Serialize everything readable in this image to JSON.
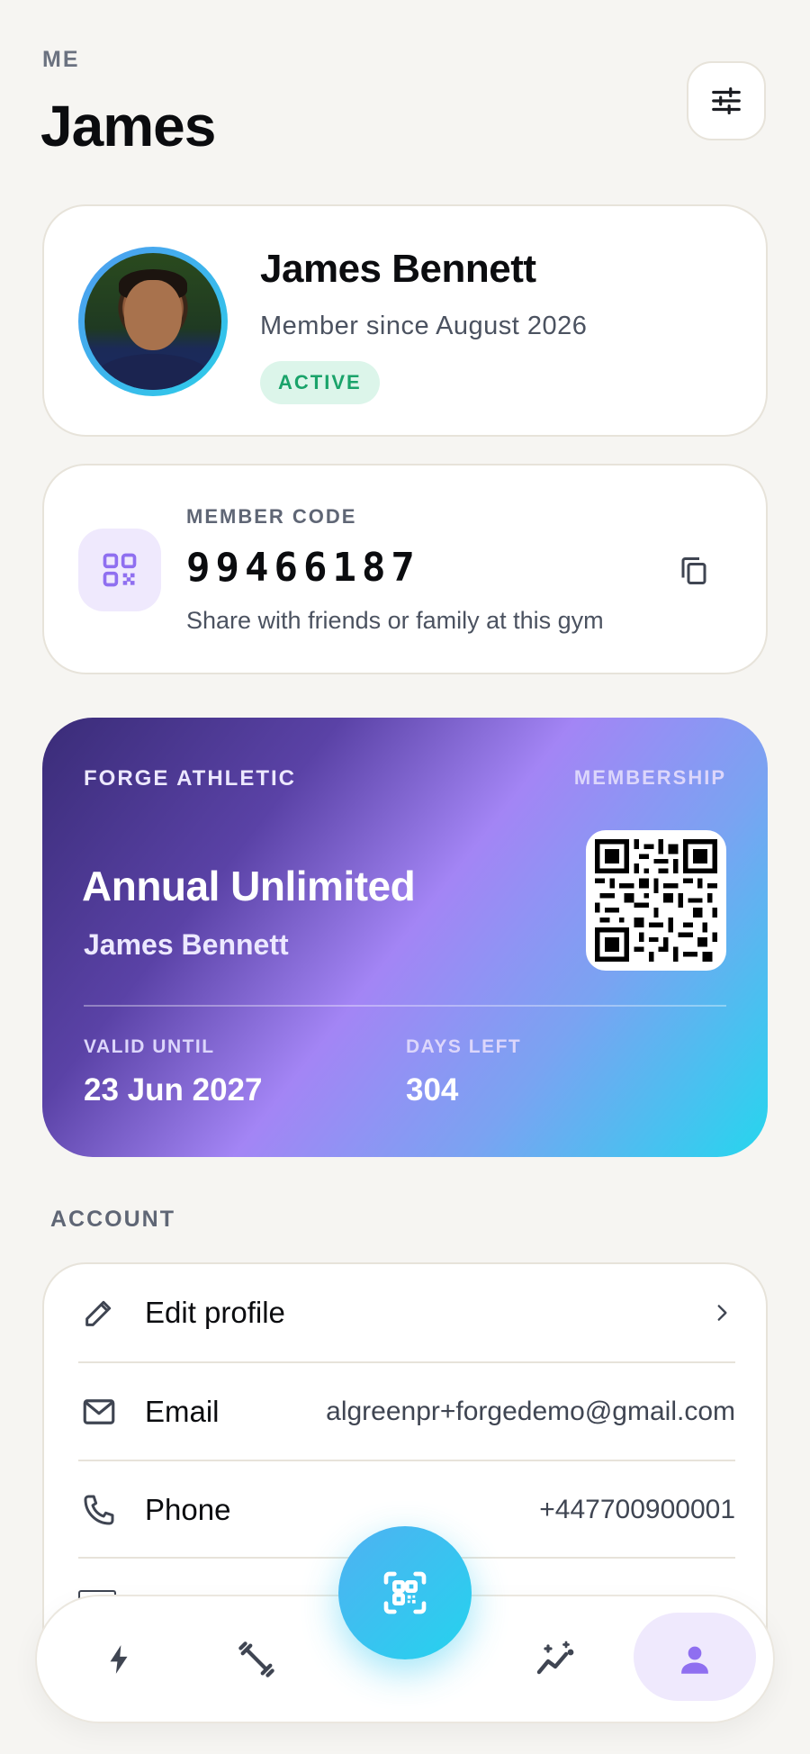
{
  "header": {
    "overline": "ME",
    "title": "James"
  },
  "profile": {
    "name": "James Bennett",
    "member_since": "Member since August 2026",
    "status": "ACTIVE"
  },
  "member_code": {
    "label": "MEMBER CODE",
    "value": "99466187",
    "hint": "Share with friends or family at this gym"
  },
  "membership_card": {
    "gym": "FORGE ATHLETIC",
    "type_label": "MEMBERSHIP",
    "plan": "Annual Unlimited",
    "holder": "James Bennett",
    "valid_until_label": "VALID UNTIL",
    "valid_until": "23 Jun 2027",
    "days_left_label": "DAYS LEFT",
    "days_left": "304",
    "gradient_colors": [
      "#3a2c78",
      "#a385f5",
      "#25d6ee"
    ]
  },
  "account": {
    "section_label": "ACCOUNT",
    "rows": [
      {
        "icon": "pencil-icon",
        "label": "Edit profile",
        "value": ""
      },
      {
        "icon": "mail-icon",
        "label": "Email",
        "value": "algreenpr+forgedemo@gmail.com"
      },
      {
        "icon": "phone-icon",
        "label": "Phone",
        "value": "+447700900001"
      }
    ]
  },
  "nav": {
    "items": [
      "bolt-icon",
      "dumbbell-icon",
      "scan-icon",
      "trend-icon",
      "person-icon"
    ],
    "active": "person-icon"
  },
  "colors": {
    "accent": "#25d3ee",
    "purple": "#8f6ff0",
    "status_green": "#1aa36a",
    "background": "#f6f5f2"
  }
}
